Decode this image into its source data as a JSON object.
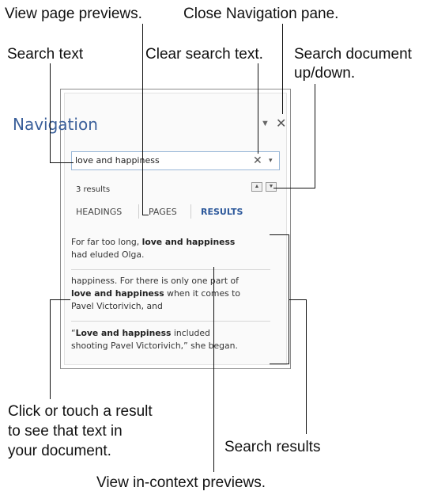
{
  "callouts": {
    "view_page_previews": "View page previews.",
    "close_nav_pane": "Close Navigation pane.",
    "search_text": "Search text",
    "clear_search_text": "Clear search text.",
    "search_document_1": "Search document",
    "search_document_2": "up/down.",
    "click_result_1": "Click or touch a result",
    "click_result_2": "to see that text in",
    "click_result_3": "your document.",
    "search_results": "Search results",
    "view_in_context": "View in-context previews."
  },
  "pane": {
    "title": "Navigation",
    "menu_icon": "dropdown-arrow-icon",
    "close_icon": "close-icon",
    "search": {
      "value": "love and happiness",
      "clear_glyph": "✕",
      "options_glyph": "▾"
    },
    "results_count": "3 results",
    "prev_glyph": "▲",
    "next_glyph": "▼",
    "tabs": [
      {
        "label": "HEADINGS"
      },
      {
        "label": "PAGES"
      },
      {
        "label": "RESULTS"
      }
    ],
    "active_tab": "RESULTS",
    "results": [
      {
        "line1_pre": "For far too long, ",
        "line1_bold": "love and happiness",
        "line2": "had eluded Olga."
      },
      {
        "line1": "happiness. For there is only one part of",
        "line2_bold": "love and happiness",
        "line2_post": " when it comes to",
        "line3": "Pavel Victorivich, and"
      },
      {
        "line1_pre": "“",
        "line1_bold": "Love and happiness",
        "line1_post": " included",
        "line2": "shooting Pavel Victorivich,” she began."
      }
    ]
  },
  "colors": {
    "title": "#3a5f9a",
    "active_tab": "#2b579a",
    "pane_border": "#8c8c8c",
    "search_border": "#9ab8d8"
  }
}
